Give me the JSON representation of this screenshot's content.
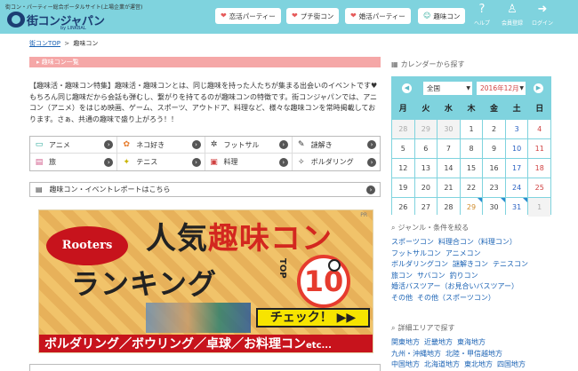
{
  "header": {
    "tagline": "街コン・パーティー総合ポータルサイト(上場企業が運営)",
    "logo": "街コンジャパン",
    "logo_sub": "by LINKBAL",
    "nav": [
      {
        "label": "恋活パーティー",
        "icon": "heart-icon",
        "color": "#e65a5a"
      },
      {
        "label": "プチ街コン",
        "icon": "heart-icon",
        "color": "#e65a5a"
      },
      {
        "label": "婚活パーティー",
        "icon": "heart-icon",
        "color": "#e65a5a"
      },
      {
        "label": "趣味コン",
        "icon": "smile-icon",
        "color": "#2aa99a"
      }
    ],
    "utils": [
      {
        "label": "ヘルプ",
        "icon": "help-icon"
      },
      {
        "label": "会員登録",
        "icon": "user-plus-icon"
      },
      {
        "label": "ログイン",
        "icon": "login-icon"
      }
    ]
  },
  "breadcrumb": {
    "home": "街コンTOP",
    "sep": ">",
    "current": "趣味コン"
  },
  "main": {
    "section_title": "趣味コン一覧",
    "intro": "【趣味活・趣味コン特集】趣味活・趣味コンとは、同じ趣味を持った人たちが集まる出会いのイベントです♥もちろん同じ趣味だから会話も弾むし、繋がりを持てるのが趣味コンの特徴です。街コンジャパンでは、アニコン（アニメ）をはじめ映画、ゲーム、スポーツ、アウトドア、料理など、様々な趣味コンを常時掲載しております。さぁ、共通の趣味で盛り上がろう！！",
    "tags": [
      {
        "label": "アニメ",
        "icon": "tv-icon",
        "glyph": "▭"
      },
      {
        "label": "ネコ好き",
        "icon": "paw-icon",
        "glyph": "✿"
      },
      {
        "label": "フットサル",
        "icon": "futsal-icon",
        "glyph": "✲"
      },
      {
        "label": "謎解き",
        "icon": "puzzle-icon",
        "glyph": "✎"
      },
      {
        "label": "旅",
        "icon": "suitcase-icon",
        "glyph": "▤"
      },
      {
        "label": "テニス",
        "icon": "tennis-icon",
        "glyph": "✦"
      },
      {
        "label": "料理",
        "icon": "cooking-icon",
        "glyph": "▣"
      },
      {
        "label": "ボルダリング",
        "icon": "climbing-icon",
        "glyph": "✧"
      }
    ],
    "report_link": "趣味コン・イベントレポートはこちら",
    "banner": {
      "pr": "PR",
      "brand": "Rooters",
      "title_a": "人気",
      "title_b": "趣味コン",
      "title_c": "ランキング",
      "top": "TOP",
      "rank": "10",
      "cta": "チェック！ ▶▶",
      "bottom": "ボルダリング／ボウリング／卓球／お料理コン",
      "etc": "etc..."
    }
  },
  "sidebar": {
    "calendar_title": "カレンダーから探す",
    "region": "全国",
    "month": "2016年12月",
    "dow": [
      "月",
      "火",
      "水",
      "木",
      "金",
      "土",
      "日"
    ],
    "weeks": [
      [
        "28",
        "29",
        "30",
        "1",
        "2",
        "3",
        "4"
      ],
      [
        "5",
        "6",
        "7",
        "8",
        "9",
        "10",
        "11"
      ],
      [
        "12",
        "13",
        "14",
        "15",
        "16",
        "17",
        "18"
      ],
      [
        "19",
        "20",
        "21",
        "22",
        "23",
        "24",
        "25"
      ],
      [
        "26",
        "27",
        "28",
        "29",
        "30",
        "31",
        "1"
      ]
    ],
    "genre_title": "ジャンル・条件を絞る",
    "genre_rows": [
      [
        "スポーツコン",
        "料理合コン（料理コン）"
      ],
      [
        "フットサルコン",
        "アニメコン"
      ],
      [
        "ボルダリングコン",
        "謎解きコン",
        "テニスコン"
      ],
      [
        "旅コン",
        "サバコン",
        "釣りコン"
      ],
      [
        "婚活バスツアー（お見合いバスツアー）"
      ],
      [
        "その他",
        "その他（スポーツコン）"
      ]
    ],
    "area_title": "詳細エリアで探す",
    "area_rows": [
      [
        "関東地方",
        "近畿地方",
        "東海地方"
      ],
      [
        "九州・沖縄地方",
        "北陸・甲信越地方"
      ],
      [
        "中国地方",
        "北海道地方",
        "東北地方",
        "四国地方"
      ]
    ]
  }
}
